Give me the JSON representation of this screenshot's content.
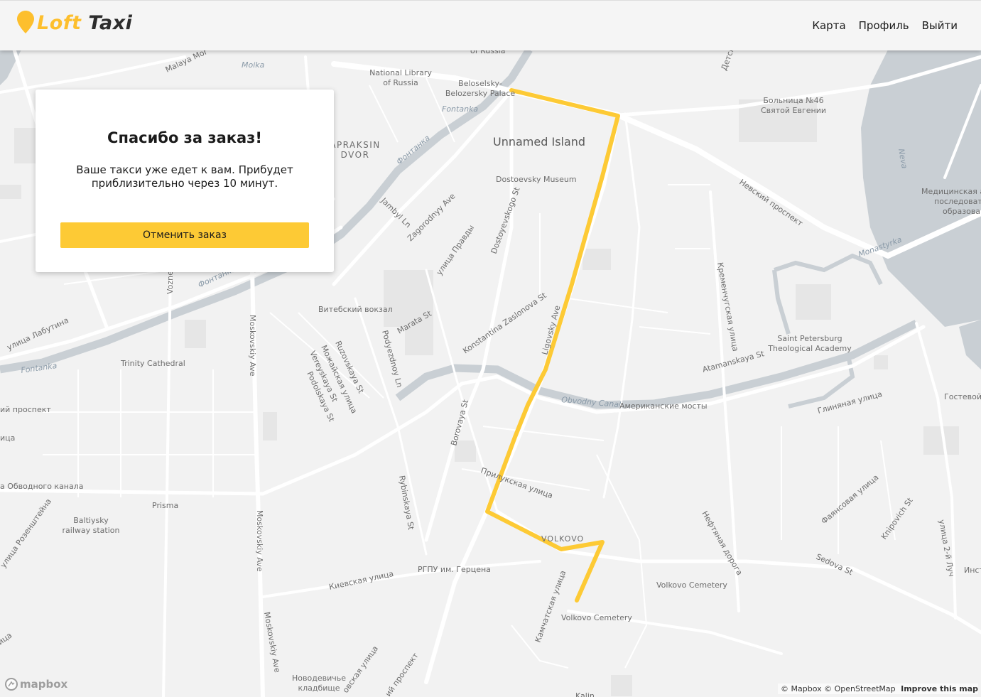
{
  "header": {
    "logo_word1": "Loft",
    "logo_word2": "Taxi",
    "nav": {
      "map": "Карта",
      "profile": "Профиль",
      "logout": "Выйти"
    }
  },
  "order_card": {
    "title": "Спасибо за заказ!",
    "message": "Ваше такси уже едет к вам. Прибудет приблизительно через 10 минут.",
    "cancel_label": "Отменить заказ"
  },
  "map": {
    "labels": {
      "national_library": [
        "National Library",
        "of Russia"
      ],
      "beloselsky": [
        "Beloselsky-",
        "Belozersky Palace"
      ],
      "of_russia": "of Russia",
      "fontanka": "Fontanka",
      "fontanka_ru": "Фонтанка",
      "moika": "Moika",
      "malaya_mor": "Malaya Mor",
      "unnamed_island": "Unnamed Island",
      "apraksin": [
        "APRAKSIN",
        "DVOR"
      ],
      "dostoevsky_museum": "Dostoevsky Museum",
      "hospital": [
        "Больница №46",
        "Святой Евгении"
      ],
      "nevsky": "Невский проспект",
      "neva": "Neva",
      "medical": [
        "Медицинская ака",
        "последовательно",
        "образован"
      ],
      "monastyrka": "Monastyrka",
      "jambyl": "Jambyl Ln",
      "zagorodny": "Zagorodnyy Ave",
      "pravdy": "улица Правды",
      "dostoyevskogo": "Dostoyevskogo St",
      "vozne": "Vozne",
      "kremenchug": "Кременчугская улица",
      "vitebsky": "Витебский вокзал",
      "marata": "Marata St",
      "zaslonova": "Konstantina Zaslonova St",
      "ligovsky": "Ligovsky Ave",
      "labutina": "улица Лабутина",
      "moskovskiy": "Moskovskiy Ave",
      "trinity": "Trinity Cathedral",
      "ruzovskaya": "Ruzovskaya St",
      "mozhayskaya": "Можайская улица",
      "vereyskaya": "Vereyskaya St",
      "podolskaya": "Podolskaya St",
      "podyezdnoy": "Podyezdnoy Ln",
      "atamanskaya": "Atamanskaya St",
      "theological": [
        "Saint Petersburg",
        "Theological Academy"
      ],
      "obvodny": "Obvodny Canal",
      "amerikanskie": "Американские мосты",
      "glinyanaya": "Глиняная улица",
      "gostevoy": "Гостевой",
      "prospekt_left": "ий проспект",
      "itsa_left": "ица",
      "borovaya": "Borovaya St",
      "prilukskaya": "Прилукская улица",
      "obvodnogo_kanala": "а Обводного канала",
      "prisma": "Prisma",
      "baltiysky": [
        "Baltiysky",
        "railway station"
      ],
      "rybinskaya": "Rybinskaya St",
      "volkovo": "VOLKOVO",
      "neftyanaya": "Нефтяная дорога",
      "faiansovaya": "Фаянсовая улица",
      "knipovich": "Knipovich St",
      "ulitsa_2": "улица 2-й Луч",
      "sedova": "Sedova St",
      "inst": "Инст",
      "rozenshteyna": "улица Розенштейна",
      "rgpu": "РГПУ им. Герцена",
      "kievskaya": "Киевская улица",
      "kamchatskaya": "Камчатская улица",
      "volkovo_cem1": "Volkovo Cemetery",
      "volkovo_cem2": "Volkovo Cemetery",
      "novodevichye": [
        "Новодевичье",
        "кладбище"
      ],
      "itsa_bottom": "ица",
      "bottom_prospekt": "ий проспект",
      "bottom_ovskaya": "овская улица",
      "detsk": "Детск",
      "kalinin": "Kalin"
    },
    "attribution": {
      "mapbox": "© Mapbox",
      "osm": "© OpenStreetMap",
      "improve": "Improve this map"
    },
    "mapbox_logo": "mapbox",
    "route_color": "#fdca35",
    "logo_color": "#fdbf2d"
  }
}
